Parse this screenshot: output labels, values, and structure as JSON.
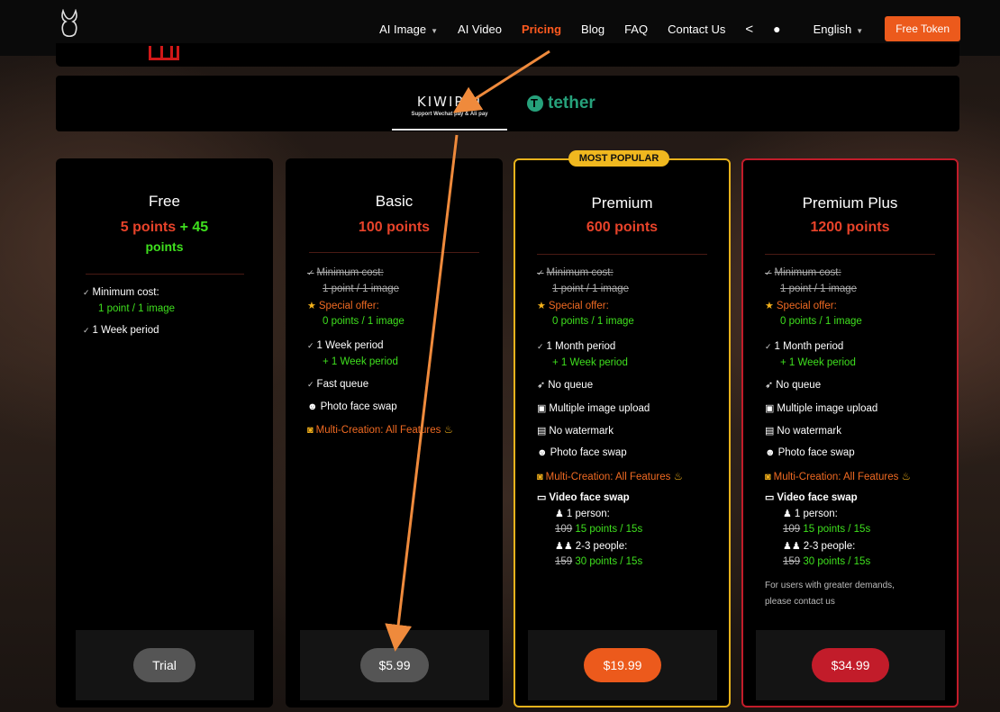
{
  "nav": {
    "items": [
      {
        "label": "AI Image",
        "dropdown": true
      },
      {
        "label": "AI Video",
        "dropdown": false
      },
      {
        "label": "Pricing",
        "active": true
      },
      {
        "label": "Blog"
      },
      {
        "label": "FAQ"
      },
      {
        "label": "Contact Us"
      }
    ],
    "share_icon": "share-icon",
    "theme_icon": "flame-icon",
    "language": "English",
    "token_button": "Free Token"
  },
  "payment": {
    "kiwipin_name": "KIWIPIN",
    "kiwipin_sub": "Support Wechat pay & Ali pay",
    "tether": "tether"
  },
  "popular_badge": "MOST POPULAR",
  "plans": {
    "free": {
      "title": "Free",
      "points_a": "5 points",
      "points_b": "+ 45",
      "points_c": "points",
      "f1": "Minimum cost:",
      "f1s": "1 point / 1 image",
      "f2": "1 Week period",
      "price": "Trial"
    },
    "basic": {
      "title": "Basic",
      "points": "100 points",
      "f1": "Minimum cost:",
      "f1s": "1 point / 1 image",
      "f2": "Special offer:",
      "f2s": "0 points / 1 image",
      "f3": "1 Week period",
      "f3s": "+ 1 Week period",
      "f4": "Fast queue",
      "f5": "Photo face swap",
      "f6": "Multi-Creation: All Features",
      "price": "$5.99"
    },
    "premium": {
      "title": "Premium",
      "points": "600 points",
      "f1": "Minimum cost:",
      "f1s": "1 point / 1 image",
      "f2": "Special offer:",
      "f2s": "0 points / 1 image",
      "f3": "1 Month period",
      "f3s": "+ 1 Week period",
      "f4": "No queue",
      "f5": "Multiple image upload",
      "f6": "No watermark",
      "f7": "Photo face swap",
      "f8": "Multi-Creation: All Features",
      "f9": "Video face swap",
      "p1": "1 person:",
      "p1old": "109",
      "p1new": "15 points / 15s",
      "p2": "2-3 people:",
      "p2old": "159",
      "p2new": "30 points / 15s",
      "price": "$19.99"
    },
    "plus": {
      "title": "Premium Plus",
      "points": "1200 points",
      "f1": "Minimum cost:",
      "f1s": "1 point / 1 image",
      "f2": "Special offer:",
      "f2s": "0 points / 1 image",
      "f3": "1 Month period",
      "f3s": "+ 1 Week period",
      "f4": "No queue",
      "f5": "Multiple image upload",
      "f6": "No watermark",
      "f7": "Photo face swap",
      "f8": "Multi-Creation: All Features",
      "f9": "Video face swap",
      "p1": "1 person:",
      "p1old": "109",
      "p1new": "15 points / 15s",
      "p2": "2-3 people:",
      "p2old": "159",
      "p2new": "30 points / 15s",
      "note1": "For users with greater demands,",
      "note2": "please contact us",
      "price": "$34.99"
    }
  },
  "colors": {
    "accent": "#ec5a1c",
    "points_red": "#e8432a",
    "green": "#3fe01e",
    "gold": "#f0b81f",
    "plus_red": "#c21c2a"
  }
}
